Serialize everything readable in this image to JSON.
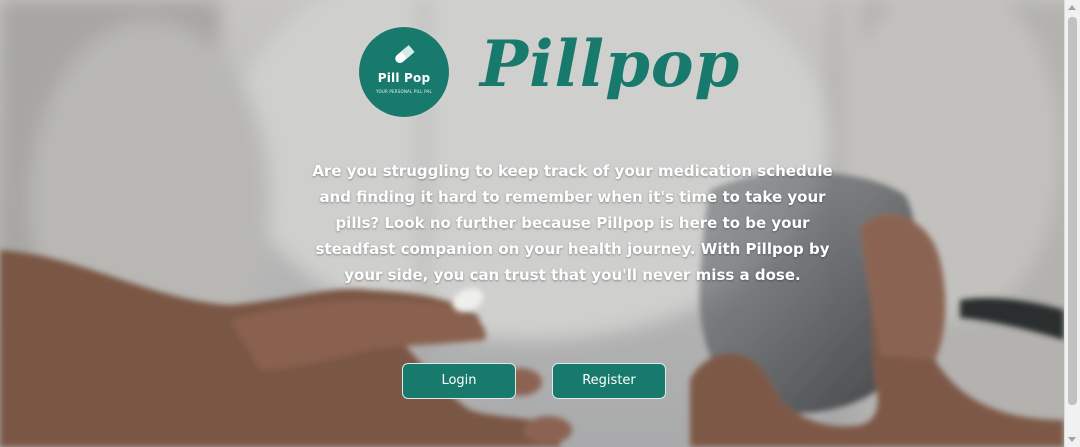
{
  "brand": {
    "name": "Pillpop",
    "logo_text": "Pill Pop",
    "logo_tagline": "YOUR PERSONAL PILL PAL",
    "color": "#177a6d"
  },
  "intro": {
    "text": "Are you struggling to keep track of your medication schedule and finding it hard to remember when it's time to take your pills? Look no further because Pillpop is here to be your steadfast companion on your health journey. With Pillpop by your side, you can trust that you'll never miss a dose."
  },
  "actions": {
    "login_label": "Login",
    "register_label": "Register"
  },
  "icons": {
    "logo_icon": "pill-capsule-icon"
  }
}
